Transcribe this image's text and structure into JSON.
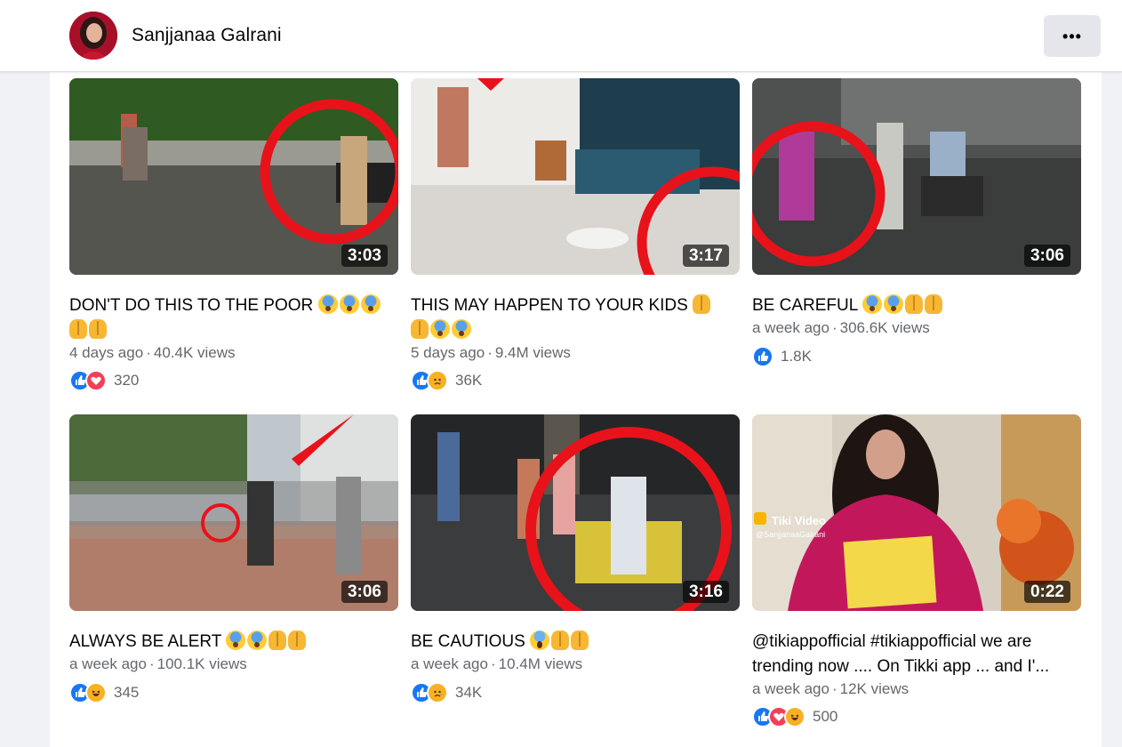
{
  "header": {
    "profile_name": "Sanjjanaa Galrani",
    "more_label": "•••"
  },
  "colors": {
    "background": "#f0f2f5",
    "like_blue": "#1877f2",
    "love_red": "#f33e58",
    "meta_gray": "#65676b",
    "annotation_red": "#e8121a"
  },
  "videos": [
    {
      "title": "DON'T DO THIS TO THE POOR",
      "emoji_line1": [
        "fear",
        "fear",
        "fear"
      ],
      "emoji_line2": [
        "pray",
        "pray"
      ],
      "age": "4 days ago",
      "views": "40.4K views",
      "duration": "3:03",
      "reactions": [
        "like-icon",
        "love-icon"
      ],
      "reaction_count": "320"
    },
    {
      "title": "THIS MAY HAPPEN TO YOUR KIDS",
      "emoji_line1": [
        "pray"
      ],
      "emoji_line2": [
        "pray",
        "fear",
        "fear"
      ],
      "age": "5 days ago",
      "views": "9.4M views",
      "duration": "3:17",
      "reactions": [
        "like-icon",
        "sad-icon"
      ],
      "reaction_count": "36K"
    },
    {
      "title": "BE CAREFUL",
      "emoji_line1": [
        "fear",
        "fear",
        "pray",
        "pray"
      ],
      "age": "a week ago",
      "views": "306.6K views",
      "duration": "3:06",
      "reactions": [
        "like-icon"
      ],
      "reaction_count": "1.8K"
    },
    {
      "title": "ALWAYS BE ALERT",
      "emoji_line1": [
        "fear",
        "fear",
        "pray",
        "pray"
      ],
      "age": "a week ago",
      "views": "100.1K views",
      "duration": "3:06",
      "reactions": [
        "like-icon",
        "haha-icon"
      ],
      "reaction_count": "345"
    },
    {
      "title": "BE CAUTIOUS",
      "emoji_line1": [
        "scream",
        "pray",
        "pray"
      ],
      "age": "a week ago",
      "views": "10.4M views",
      "duration": "3:16",
      "reactions": [
        "like-icon",
        "sad-icon"
      ],
      "reaction_count": "34K"
    },
    {
      "title_line1": "@tikiappofficial #tikiappofficial we are",
      "title_line2": "trending now .... On Tikki app ... and I'...",
      "age": "a week ago",
      "views": "12K views",
      "duration": "0:22",
      "reactions": [
        "like-icon",
        "love-icon",
        "haha-icon"
      ],
      "reaction_count": "500",
      "watermark_brand": "Tiki Video",
      "watermark_handle": "@SanjjanaaGalrani"
    }
  ]
}
